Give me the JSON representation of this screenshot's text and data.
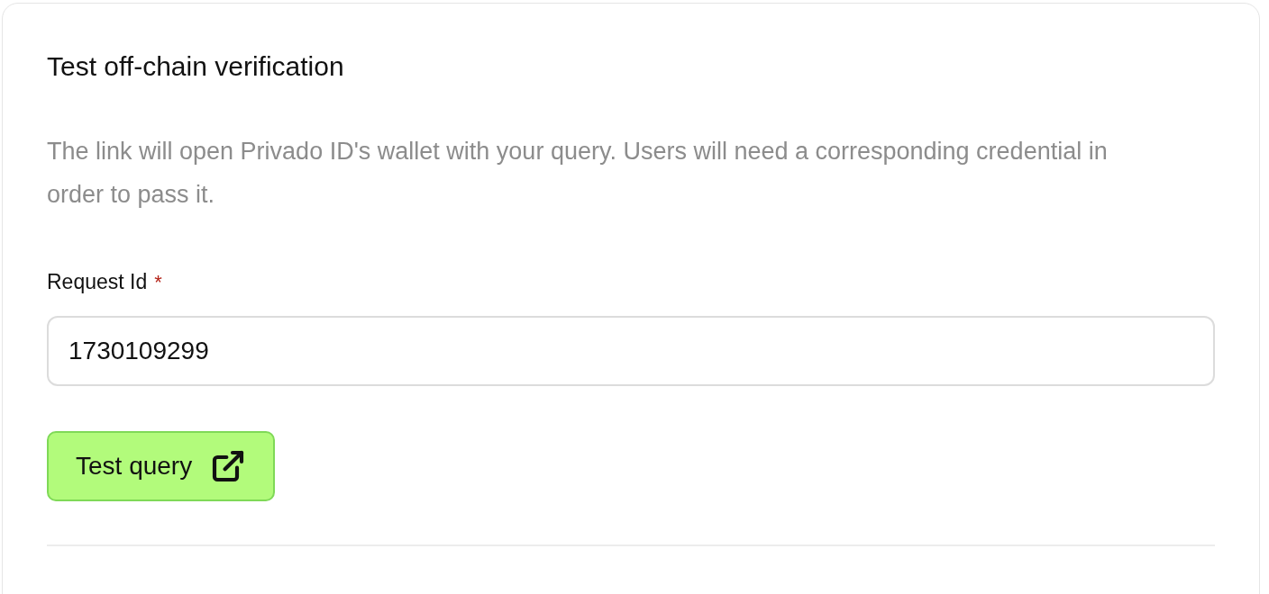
{
  "card": {
    "title": "Test off-chain verification",
    "description": "The link will open Privado ID's wallet with your query. Users will need a corresponding credential in order to pass it.",
    "field": {
      "label": "Request Id",
      "required": true,
      "required_mark": "*",
      "value": "1730109299"
    },
    "button": {
      "label": "Test query"
    }
  }
}
